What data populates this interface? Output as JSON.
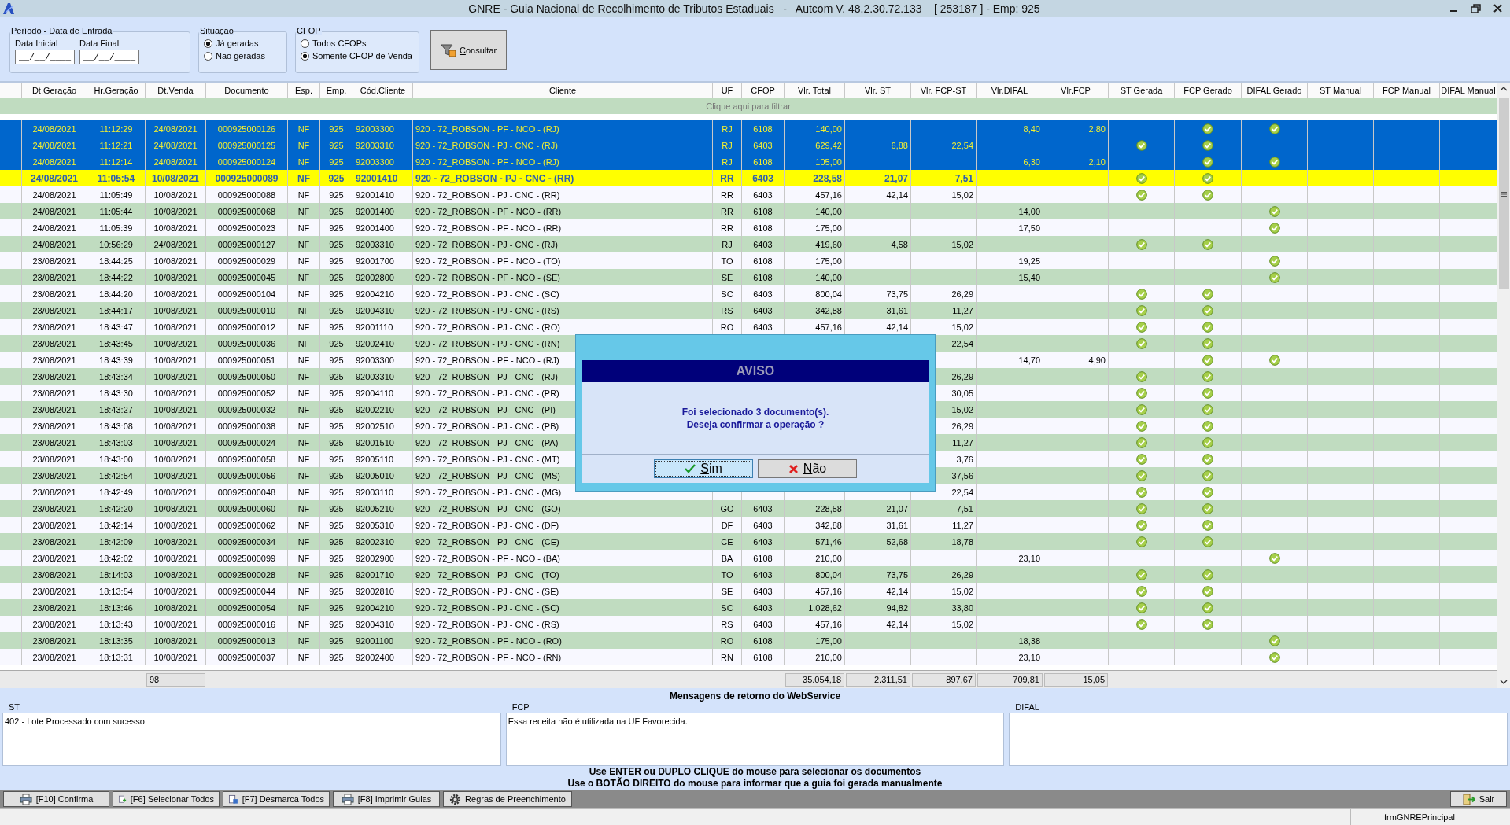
{
  "window": {
    "title": "GNRE - Guia Nacional de Recolhimento de Tributos Estaduais   -   Autcom V. 48.2.30.72.133    [ 253187 ] - Emp: 925"
  },
  "filters": {
    "period": {
      "legend": "Período - Data de Entrada",
      "fields": [
        {
          "label": "Data Inicial",
          "value": "__/__/____"
        },
        {
          "label": "Data Final",
          "value": "__/__/____"
        }
      ]
    },
    "situacao": {
      "legend": "Situação",
      "options": [
        {
          "label": "Já geradas",
          "selected": true
        },
        {
          "label": "Não geradas",
          "selected": false
        }
      ]
    },
    "cfop": {
      "legend": "CFOP",
      "options": [
        {
          "label": "Todos CFOPs",
          "selected": false
        },
        {
          "label": "Somente CFOP de Venda",
          "selected": true
        }
      ]
    },
    "consult_button": "Consultar"
  },
  "grid": {
    "columns": [
      "Dt.Geração",
      "Hr.Geração",
      "Dt.Venda",
      "Documento",
      "Esp.",
      "Emp.",
      "Cód.Cliente",
      "Cliente",
      "UF",
      "CFOP",
      "Vlr. Total",
      "Vlr. ST",
      "Vlr. FCP-ST",
      "Vlr.DIFAL",
      "Vlr.FCP",
      "ST Gerada",
      "FCP Gerado",
      "DIFAL Gerado",
      "ST Manual",
      "FCP Manual",
      "DIFAL Manual"
    ],
    "filter_hint": "Clique aqui para filtrar",
    "rows": [
      {
        "dt_geracao": "24/08/2021",
        "hr_geracao": "11:12:29",
        "dt_venda": "24/08/2021",
        "documento": "000925000126",
        "esp": "NF",
        "emp": "925",
        "cod_cliente": "92003300",
        "cliente": "920 - 72_ROBSON - PF - NCO - (RJ)",
        "uf": "RJ",
        "cfop": "6108",
        "vlr_total": "140,00",
        "vlr_difal": "8,40",
        "vlr_fcp": "2,80",
        "st_gerada": false,
        "fcp_gerado": true,
        "difal_gerado": true,
        "selected": true,
        "focused": false
      },
      {
        "dt_geracao": "24/08/2021",
        "hr_geracao": "11:12:21",
        "dt_venda": "24/08/2021",
        "documento": "000925000125",
        "esp": "NF",
        "emp": "925",
        "cod_cliente": "92003310",
        "cliente": "920 - 72_ROBSON - PJ - CNC - (RJ)",
        "uf": "RJ",
        "cfop": "6403",
        "vlr_total": "629,42",
        "vlr_st": "6,88",
        "vlr_fcp_st": "22,54",
        "st_gerada": true,
        "fcp_gerado": true,
        "difal_gerado": false,
        "selected": true,
        "focused": false
      },
      {
        "dt_geracao": "24/08/2021",
        "hr_geracao": "11:12:14",
        "dt_venda": "24/08/2021",
        "documento": "000925000124",
        "esp": "NF",
        "emp": "925",
        "cod_cliente": "92003300",
        "cliente": "920 - 72_ROBSON - PF - NCO - (RJ)",
        "uf": "RJ",
        "cfop": "6108",
        "vlr_total": "105,00",
        "vlr_difal": "6,30",
        "vlr_fcp": "2,10",
        "st_gerada": false,
        "fcp_gerado": true,
        "difal_gerado": true,
        "selected": true,
        "focused": false
      },
      {
        "dt_geracao": "24/08/2021",
        "hr_geracao": "11:05:54",
        "dt_venda": "10/08/2021",
        "documento": "000925000089",
        "esp": "NF",
        "emp": "925",
        "cod_cliente": "92001410",
        "cliente": "920 - 72_ROBSON - PJ - CNC - (RR)",
        "uf": "RR",
        "cfop": "6403",
        "vlr_total": "228,58",
        "vlr_st": "21,07",
        "vlr_fcp_st": "7,51",
        "st_gerada": true,
        "fcp_gerado": true,
        "difal_gerado": false,
        "selected": false,
        "focused": true
      },
      {
        "dt_geracao": "24/08/2021",
        "hr_geracao": "11:05:49",
        "dt_venda": "10/08/2021",
        "documento": "000925000088",
        "esp": "NF",
        "emp": "925",
        "cod_cliente": "92001410",
        "cliente": "920 - 72_ROBSON - PJ - CNC - (RR)",
        "uf": "RR",
        "cfop": "6403",
        "vlr_total": "457,16",
        "vlr_st": "42,14",
        "vlr_fcp_st": "15,02",
        "st_gerada": true,
        "fcp_gerado": true,
        "difal_gerado": false,
        "selected": false,
        "focused": false
      },
      {
        "dt_geracao": "24/08/2021",
        "hr_geracao": "11:05:44",
        "dt_venda": "10/08/2021",
        "documento": "000925000068",
        "esp": "NF",
        "emp": "925",
        "cod_cliente": "92001400",
        "cliente": "920 - 72_ROBSON - PF - NCO - (RR)",
        "uf": "RR",
        "cfop": "6108",
        "vlr_total": "140,00",
        "vlr_difal": "14,00",
        "st_gerada": false,
        "fcp_gerado": false,
        "difal_gerado": true,
        "selected": false,
        "focused": false
      },
      {
        "dt_geracao": "24/08/2021",
        "hr_geracao": "11:05:39",
        "dt_venda": "10/08/2021",
        "documento": "000925000023",
        "esp": "NF",
        "emp": "925",
        "cod_cliente": "92001400",
        "cliente": "920 - 72_ROBSON - PF - NCO - (RR)",
        "uf": "RR",
        "cfop": "6108",
        "vlr_total": "175,00",
        "vlr_difal": "17,50",
        "st_gerada": false,
        "fcp_gerado": false,
        "difal_gerado": true,
        "selected": false,
        "focused": false
      },
      {
        "dt_geracao": "24/08/2021",
        "hr_geracao": "10:56:29",
        "dt_venda": "24/08/2021",
        "documento": "000925000127",
        "esp": "NF",
        "emp": "925",
        "cod_cliente": "92003310",
        "cliente": "920 - 72_ROBSON - PJ - CNC - (RJ)",
        "uf": "RJ",
        "cfop": "6403",
        "vlr_total": "419,60",
        "vlr_st": "4,58",
        "vlr_fcp_st": "15,02",
        "st_gerada": true,
        "fcp_gerado": true,
        "difal_gerado": false,
        "selected": false,
        "focused": false
      },
      {
        "dt_geracao": "23/08/2021",
        "hr_geracao": "18:44:25",
        "dt_venda": "10/08/2021",
        "documento": "000925000029",
        "esp": "NF",
        "emp": "925",
        "cod_cliente": "92001700",
        "cliente": "920 - 72_ROBSON - PF - NCO - (TO)",
        "uf": "TO",
        "cfop": "6108",
        "vlr_total": "175,00",
        "vlr_difal": "19,25",
        "st_gerada": false,
        "fcp_gerado": false,
        "difal_gerado": true,
        "selected": false,
        "focused": false
      },
      {
        "dt_geracao": "23/08/2021",
        "hr_geracao": "18:44:22",
        "dt_venda": "10/08/2021",
        "documento": "000925000045",
        "esp": "NF",
        "emp": "925",
        "cod_cliente": "92002800",
        "cliente": "920 - 72_ROBSON - PF - NCO - (SE)",
        "uf": "SE",
        "cfop": "6108",
        "vlr_total": "140,00",
        "vlr_difal": "15,40",
        "st_gerada": false,
        "fcp_gerado": false,
        "difal_gerado": true,
        "selected": false,
        "focused": false
      },
      {
        "dt_geracao": "23/08/2021",
        "hr_geracao": "18:44:20",
        "dt_venda": "10/08/2021",
        "documento": "000925000104",
        "esp": "NF",
        "emp": "925",
        "cod_cliente": "92004210",
        "cliente": "920 - 72_ROBSON - PJ - CNC - (SC)",
        "uf": "SC",
        "cfop": "6403",
        "vlr_total": "800,04",
        "vlr_st": "73,75",
        "vlr_fcp_st": "26,29",
        "st_gerada": true,
        "fcp_gerado": true,
        "difal_gerado": false,
        "selected": false,
        "focused": false
      },
      {
        "dt_geracao": "23/08/2021",
        "hr_geracao": "18:44:17",
        "dt_venda": "10/08/2021",
        "documento": "000925000010",
        "esp": "NF",
        "emp": "925",
        "cod_cliente": "92004310",
        "cliente": "920 - 72_ROBSON - PJ - CNC - (RS)",
        "uf": "RS",
        "cfop": "6403",
        "vlr_total": "342,88",
        "vlr_st": "31,61",
        "vlr_fcp_st": "11,27",
        "st_gerada": true,
        "fcp_gerado": true,
        "difal_gerado": false,
        "selected": false,
        "focused": false
      },
      {
        "dt_geracao": "23/08/2021",
        "hr_geracao": "18:43:47",
        "dt_venda": "10/08/2021",
        "documento": "000925000012",
        "esp": "NF",
        "emp": "925",
        "cod_cliente": "92001110",
        "cliente": "920 - 72_ROBSON - PJ - CNC - (RO)",
        "uf": "RO",
        "cfop": "6403",
        "vlr_total": "457,16",
        "vlr_st": "42,14",
        "vlr_fcp_st": "15,02",
        "st_gerada": true,
        "fcp_gerado": true,
        "difal_gerado": false,
        "selected": false,
        "focused": false
      },
      {
        "dt_geracao": "23/08/2021",
        "hr_geracao": "18:43:45",
        "dt_venda": "10/08/2021",
        "documento": "000925000036",
        "esp": "NF",
        "emp": "925",
        "cod_cliente": "92002410",
        "cliente": "920 - 72_ROBSON - PJ - CNC - (RN)",
        "vlr_fcp_st": "22,54",
        "st_gerada": true,
        "fcp_gerado": true,
        "difal_gerado": false,
        "selected": false,
        "focused": false
      },
      {
        "dt_geracao": "23/08/2021",
        "hr_geracao": "18:43:39",
        "dt_venda": "10/08/2021",
        "documento": "000925000051",
        "esp": "NF",
        "emp": "925",
        "cod_cliente": "92003300",
        "cliente": "920 - 72_ROBSON - PF - NCO - (RJ)",
        "vlr_difal": "14,70",
        "vlr_fcp": "4,90",
        "st_gerada": false,
        "fcp_gerado": true,
        "difal_gerado": true,
        "selected": false,
        "focused": false
      },
      {
        "dt_geracao": "23/08/2021",
        "hr_geracao": "18:43:34",
        "dt_venda": "10/08/2021",
        "documento": "000925000050",
        "esp": "NF",
        "emp": "925",
        "cod_cliente": "92003310",
        "cliente": "920 - 72_ROBSON - PJ - CNC - (RJ)",
        "vlr_fcp_st": "26,29",
        "st_gerada": true,
        "fcp_gerado": true,
        "difal_gerado": false,
        "selected": false,
        "focused": false
      },
      {
        "dt_geracao": "23/08/2021",
        "hr_geracao": "18:43:30",
        "dt_venda": "10/08/2021",
        "documento": "000925000052",
        "esp": "NF",
        "emp": "925",
        "cod_cliente": "92004110",
        "cliente": "920 - 72_ROBSON - PJ - CNC - (PR)",
        "vlr_fcp_st": "30,05",
        "st_gerada": true,
        "fcp_gerado": true,
        "difal_gerado": false,
        "selected": false,
        "focused": false
      },
      {
        "dt_geracao": "23/08/2021",
        "hr_geracao": "18:43:27",
        "dt_venda": "10/08/2021",
        "documento": "000925000032",
        "esp": "NF",
        "emp": "925",
        "cod_cliente": "92002210",
        "cliente": "920 - 72_ROBSON - PJ - CNC - (PI)",
        "vlr_fcp_st": "15,02",
        "st_gerada": true,
        "fcp_gerado": true,
        "difal_gerado": false,
        "selected": false,
        "focused": false
      },
      {
        "dt_geracao": "23/08/2021",
        "hr_geracao": "18:43:08",
        "dt_venda": "10/08/2021",
        "documento": "000925000038",
        "esp": "NF",
        "emp": "925",
        "cod_cliente": "92002510",
        "cliente": "920 - 72_ROBSON - PJ - CNC - (PB)",
        "vlr_fcp_st": "26,29",
        "st_gerada": true,
        "fcp_gerado": true,
        "difal_gerado": false,
        "selected": false,
        "focused": false
      },
      {
        "dt_geracao": "23/08/2021",
        "hr_geracao": "18:43:03",
        "dt_venda": "10/08/2021",
        "documento": "000925000024",
        "esp": "NF",
        "emp": "925",
        "cod_cliente": "92001510",
        "cliente": "920 - 72_ROBSON - PJ - CNC - (PA)",
        "vlr_fcp_st": "11,27",
        "st_gerada": true,
        "fcp_gerado": true,
        "difal_gerado": false,
        "selected": false,
        "focused": false
      },
      {
        "dt_geracao": "23/08/2021",
        "hr_geracao": "18:43:00",
        "dt_venda": "10/08/2021",
        "documento": "000925000058",
        "esp": "NF",
        "emp": "925",
        "cod_cliente": "92005110",
        "cliente": "920 - 72_ROBSON - PJ - CNC - (MT)",
        "vlr_fcp_st": "3,76",
        "st_gerada": true,
        "fcp_gerado": true,
        "difal_gerado": false,
        "selected": false,
        "focused": false
      },
      {
        "dt_geracao": "23/08/2021",
        "hr_geracao": "18:42:54",
        "dt_venda": "10/08/2021",
        "documento": "000925000056",
        "esp": "NF",
        "emp": "925",
        "cod_cliente": "92005010",
        "cliente": "920 - 72_ROBSON - PJ - CNC - (MS)",
        "vlr_fcp_st": "37,56",
        "st_gerada": true,
        "fcp_gerado": true,
        "difal_gerado": false,
        "selected": false,
        "focused": false
      },
      {
        "dt_geracao": "23/08/2021",
        "hr_geracao": "18:42:49",
        "dt_venda": "10/08/2021",
        "documento": "000925000048",
        "esp": "NF",
        "emp": "925",
        "cod_cliente": "92003110",
        "cliente": "920 - 72_ROBSON - PJ - CNC - (MG)",
        "vlr_fcp_st": "22,54",
        "st_gerada": true,
        "fcp_gerado": true,
        "difal_gerado": false,
        "selected": false,
        "focused": false
      },
      {
        "dt_geracao": "23/08/2021",
        "hr_geracao": "18:42:20",
        "dt_venda": "10/08/2021",
        "documento": "000925000060",
        "esp": "NF",
        "emp": "925",
        "cod_cliente": "92005210",
        "cliente": "920 - 72_ROBSON - PJ - CNC - (GO)",
        "uf": "GO",
        "cfop": "6403",
        "vlr_total": "228,58",
        "vlr_st": "21,07",
        "vlr_fcp_st": "7,51",
        "st_gerada": true,
        "fcp_gerado": true,
        "difal_gerado": false,
        "selected": false,
        "focused": false
      },
      {
        "dt_geracao": "23/08/2021",
        "hr_geracao": "18:42:14",
        "dt_venda": "10/08/2021",
        "documento": "000925000062",
        "esp": "NF",
        "emp": "925",
        "cod_cliente": "92005310",
        "cliente": "920 - 72_ROBSON - PJ - CNC - (DF)",
        "uf": "DF",
        "cfop": "6403",
        "vlr_total": "342,88",
        "vlr_st": "31,61",
        "vlr_fcp_st": "11,27",
        "st_gerada": true,
        "fcp_gerado": true,
        "difal_gerado": false,
        "selected": false,
        "focused": false
      },
      {
        "dt_geracao": "23/08/2021",
        "hr_geracao": "18:42:09",
        "dt_venda": "10/08/2021",
        "documento": "000925000034",
        "esp": "NF",
        "emp": "925",
        "cod_cliente": "92002310",
        "cliente": "920 - 72_ROBSON - PJ - CNC - (CE)",
        "uf": "CE",
        "cfop": "6403",
        "vlr_total": "571,46",
        "vlr_st": "52,68",
        "vlr_fcp_st": "18,78",
        "st_gerada": true,
        "fcp_gerado": true,
        "difal_gerado": false,
        "selected": false,
        "focused": false
      },
      {
        "dt_geracao": "23/08/2021",
        "hr_geracao": "18:42:02",
        "dt_venda": "10/08/2021",
        "documento": "000925000099",
        "esp": "NF",
        "emp": "925",
        "cod_cliente": "92002900",
        "cliente": "920 - 72_ROBSON - PF - NCO - (BA)",
        "uf": "BA",
        "cfop": "6108",
        "vlr_total": "210,00",
        "vlr_difal": "23,10",
        "st_gerada": false,
        "fcp_gerado": false,
        "difal_gerado": true,
        "selected": false,
        "focused": false
      },
      {
        "dt_geracao": "23/08/2021",
        "hr_geracao": "18:14:03",
        "dt_venda": "10/08/2021",
        "documento": "000925000028",
        "esp": "NF",
        "emp": "925",
        "cod_cliente": "92001710",
        "cliente": "920 - 72_ROBSON - PJ - CNC - (TO)",
        "uf": "TO",
        "cfop": "6403",
        "vlr_total": "800,04",
        "vlr_st": "73,75",
        "vlr_fcp_st": "26,29",
        "st_gerada": true,
        "fcp_gerado": true,
        "difal_gerado": false,
        "selected": false,
        "focused": false
      },
      {
        "dt_geracao": "23/08/2021",
        "hr_geracao": "18:13:54",
        "dt_venda": "10/08/2021",
        "documento": "000925000044",
        "esp": "NF",
        "emp": "925",
        "cod_cliente": "92002810",
        "cliente": "920 - 72_ROBSON - PJ - CNC - (SE)",
        "uf": "SE",
        "cfop": "6403",
        "vlr_total": "457,16",
        "vlr_st": "42,14",
        "vlr_fcp_st": "15,02",
        "st_gerada": true,
        "fcp_gerado": true,
        "difal_gerado": false,
        "selected": false,
        "focused": false
      },
      {
        "dt_geracao": "23/08/2021",
        "hr_geracao": "18:13:46",
        "dt_venda": "10/08/2021",
        "documento": "000925000054",
        "esp": "NF",
        "emp": "925",
        "cod_cliente": "92004210",
        "cliente": "920 - 72_ROBSON - PJ - CNC - (SC)",
        "uf": "SC",
        "cfop": "6403",
        "vlr_total": "1.028,62",
        "vlr_st": "94,82",
        "vlr_fcp_st": "33,80",
        "st_gerada": true,
        "fcp_gerado": true,
        "difal_gerado": false,
        "selected": false,
        "focused": false
      },
      {
        "dt_geracao": "23/08/2021",
        "hr_geracao": "18:13:43",
        "dt_venda": "10/08/2021",
        "documento": "000925000016",
        "esp": "NF",
        "emp": "925",
        "cod_cliente": "92004310",
        "cliente": "920 - 72_ROBSON - PJ - CNC - (RS)",
        "uf": "RS",
        "cfop": "6403",
        "vlr_total": "457,16",
        "vlr_st": "42,14",
        "vlr_fcp_st": "15,02",
        "st_gerada": true,
        "fcp_gerado": true,
        "difal_gerado": false,
        "selected": false,
        "focused": false
      },
      {
        "dt_geracao": "23/08/2021",
        "hr_geracao": "18:13:35",
        "dt_venda": "10/08/2021",
        "documento": "000925000013",
        "esp": "NF",
        "emp": "925",
        "cod_cliente": "92001100",
        "cliente": "920 - 72_ROBSON - PF - NCO - (RO)",
        "uf": "RO",
        "cfop": "6108",
        "vlr_total": "175,00",
        "vlr_difal": "18,38",
        "st_gerada": false,
        "fcp_gerado": false,
        "difal_gerado": true,
        "selected": false,
        "focused": false
      },
      {
        "dt_geracao": "23/08/2021",
        "hr_geracao": "18:13:31",
        "dt_venda": "10/08/2021",
        "documento": "000925000037",
        "esp": "NF",
        "emp": "925",
        "cod_cliente": "92002400",
        "cliente": "920 - 72_ROBSON - PF - NCO - (RN)",
        "uf": "RN",
        "cfop": "6108",
        "vlr_total": "210,00",
        "vlr_difal": "23,10",
        "st_gerada": false,
        "fcp_gerado": false,
        "difal_gerado": true,
        "selected": false,
        "focused": false
      }
    ]
  },
  "totals": {
    "count": "98",
    "vlr_total": "35.054,18",
    "vlr_st": "2.311,51",
    "vlr_fcp_st": "897,67",
    "vlr_difal": "709,81",
    "vlr_fcp": "15,05"
  },
  "dialog": {
    "title": "AVISO",
    "lines": [
      "Foi selecionado 3 documento(s).",
      "Deseja confirmar a operação ?"
    ],
    "buttons": [
      {
        "label": "Sim",
        "kind": "confirm",
        "selected": true
      },
      {
        "label": "Não",
        "kind": "cancel",
        "selected": false
      }
    ]
  },
  "messages": {
    "title": "Mensagens de retorno do WebService",
    "panels": [
      {
        "label": "ST",
        "text": "402 - Lote Processado com sucesso"
      },
      {
        "label": "FCP",
        "text": "Essa receita não é utilizada na UF Favorecida."
      },
      {
        "label": "DIFAL"
      }
    ]
  },
  "instructions": [
    "Use ENTER ou DUPLO CLIQUE do mouse para selecionar os documentos",
    "Use o BOTÃO DIREITO do mouse para informar que a guia foi gerada manualmente"
  ],
  "actions": [
    "[F10] Confirma",
    "[F6] Selecionar Todos",
    "[F7] Desmarca Todos",
    "[F8] Imprimir Guias",
    "Regras de Preenchimento"
  ],
  "exit_button": "Sair",
  "status_bar": {
    "form": "frmGNREPrincipal"
  }
}
